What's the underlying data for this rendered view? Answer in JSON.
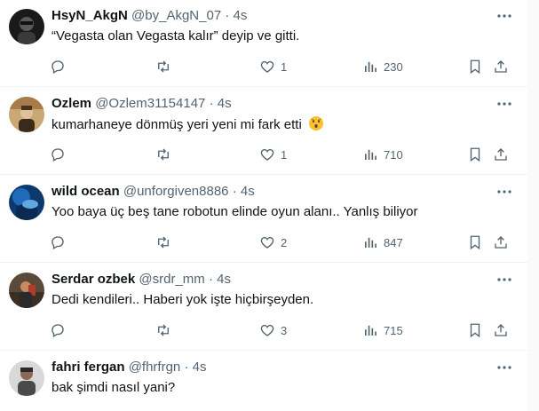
{
  "tweets": [
    {
      "name": "HsyN_AkgN",
      "handle": "@by_AkgN_07",
      "dot": "·",
      "time": "4s",
      "text": "“Vegasta olan Vegasta kalır”  deyip ve gitti.",
      "replies": "",
      "retweets": "",
      "likes": "1",
      "views": "230"
    },
    {
      "name": "Ozlem",
      "handle": "@Ozlem31154147",
      "dot": "·",
      "time": "4s",
      "text": "kumarhaneye dönmüş yeri yeni mi fark etti",
      "emoji": "hushed-face-emoji",
      "replies": "",
      "retweets": "",
      "likes": "1",
      "views": "710"
    },
    {
      "name": "wild ocean",
      "handle": "@unforgiven8886",
      "dot": "·",
      "time": "4s",
      "text": "Yoo baya üç beş tane robotun elinde oyun alanı.. Yanlış biliyor",
      "replies": "",
      "retweets": "",
      "likes": "2",
      "views": "847"
    },
    {
      "name": "Serdar ozbek",
      "handle": "@srdr_mm",
      "dot": "·",
      "time": "4s",
      "text": "Dedi kendileri.. Haberi yok işte hiçbirşeyden.",
      "replies": "",
      "retweets": "",
      "likes": "3",
      "views": "715"
    },
    {
      "name": "fahri fergan",
      "handle": "@fhrfrgn",
      "dot": "·",
      "time": "4s",
      "text": "bak şimdi nasıl yani?",
      "replies": "",
      "retweets": "",
      "likes": "",
      "views": ""
    }
  ],
  "colors": {
    "text": "#0f1419",
    "muted": "#536471",
    "divider": "#eff3f4"
  }
}
